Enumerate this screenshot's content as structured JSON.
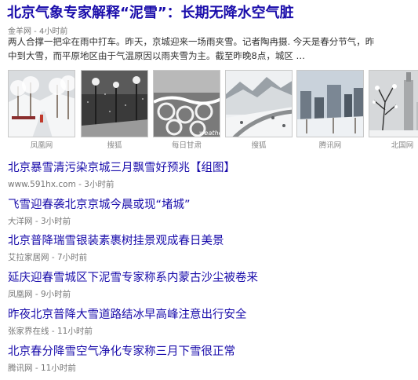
{
  "top": {
    "title": "北京气象专家解释“泥雪”：长期无降水空气脏",
    "source": "金羊网",
    "time": "4小时前",
    "snippet_line1": "两人合撑一把伞在雨中打车。昨天，京城迎来一场雨夹雪。记者陶冉摄. 今天是春分节气，昨",
    "snippet_line2": "中到大雪，而平原地区由于气温原因以雨夹雪为主。截至昨晚8点，城区 …",
    "images": [
      {
        "source": "凤凰网",
        "icon": "snowy-park-photo"
      },
      {
        "source": "搜狐",
        "icon": "night-snow-street-photo"
      },
      {
        "source": "每日甘肃",
        "icon": "snow-covered-bicycles-photo"
      },
      {
        "source": "搜狐",
        "icon": "snowy-mountain-road-photo"
      },
      {
        "source": "腾讯网",
        "icon": "city-skyline-snow-photo"
      },
      {
        "source": "北国网",
        "icon": "snow-tree-tower-photo"
      }
    ],
    "image_watermark": "weather"
  },
  "results": [
    {
      "title": "北京暴雪清污染京城三月飘雪好预兆【组图】",
      "source": "www.591hx.com",
      "time": "3小时前"
    },
    {
      "title": "飞雪迎春袭北京京城今晨或现“堵城”",
      "source": "大洋网",
      "time": "3小时前"
    },
    {
      "title": "北京普降瑞雪银装素裹树挂景观成春日美景",
      "source": "艾拉家居网",
      "time": "7小时前"
    },
    {
      "title": "延庆迎春雪城区下泥雪专家称系内蒙古沙尘被卷来",
      "source": "凤凰网",
      "time": "9小时前"
    },
    {
      "title": "昨夜北京普降大雪道路结冰早高峰注意出行安全",
      "source": "张家界在线",
      "time": "11小时前"
    },
    {
      "title": "北京春分降雪空气净化专家称三月下雪很正常",
      "source": "腾讯网",
      "time": "11小时前"
    }
  ],
  "separator": " - ",
  "colors": {
    "link": "#1a0dab",
    "meta": "#777777",
    "snippet": "#333333"
  }
}
